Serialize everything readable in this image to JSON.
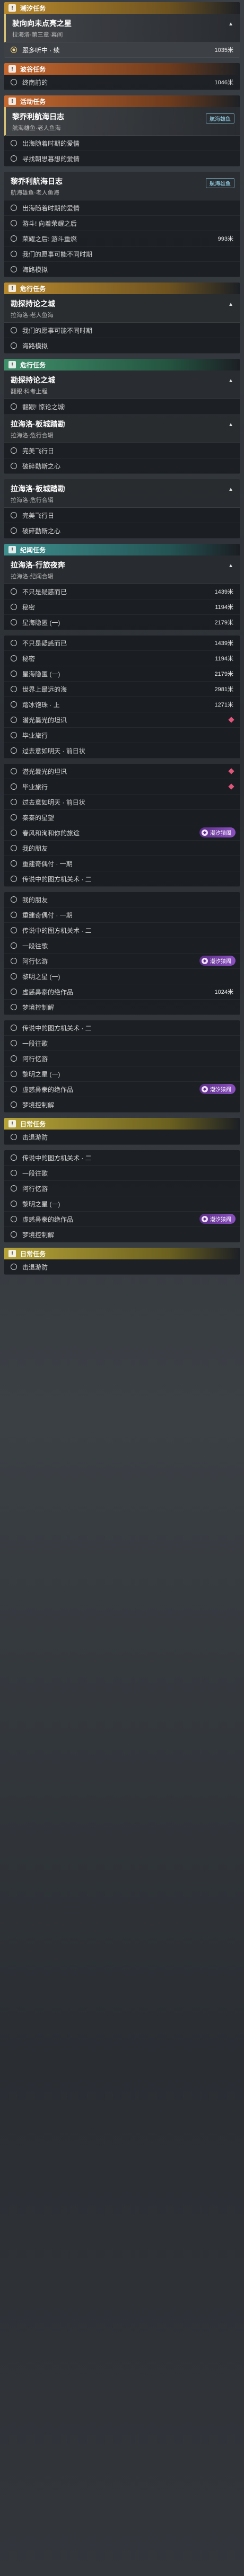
{
  "icons": {
    "category": "exclamation-icon",
    "pin": "location-pin-icon",
    "tide_badge": "tide-icon"
  },
  "colors": {
    "gold": "#b8892e",
    "orange": "#c6682f",
    "green": "#3f8f6a",
    "teal": "#3e8f8f",
    "yellow": "#b6a337",
    "purple": "#8b4fc0"
  },
  "sec1": {
    "cat": "潮汐任务",
    "quest_title": "驶向向未点亮之星",
    "quest_sub": "拉海洛·第三章·幕间",
    "steps": [
      {
        "label": "跟多听中 · 续",
        "dist": "1035米"
      }
    ]
  },
  "sec2": {
    "cat": "波谷任务",
    "steps": [
      {
        "label": "终南前的",
        "dist": "1046米"
      }
    ]
  },
  "sec3": {
    "cat": "活动任务",
    "quest_title": "黎乔利航海日志",
    "quest_sub": "航海雄鱼·老人鱼海",
    "tag": "航海雄鱼",
    "steps": [
      {
        "label": "出海随着时期的爱情"
      },
      {
        "label": "寻找朝思暮想的爱情"
      }
    ]
  },
  "sec4": {
    "quest_title": "黎乔利航海日志",
    "quest_sub": "航海雄鱼·老人鱼海",
    "tag": "航海雄鱼",
    "steps": [
      {
        "label": "出海随着时期的爱情"
      },
      {
        "label": "游斗! 向着荣耀之后"
      },
      {
        "label": "荣耀之后: 游斗重燃",
        "dist": "993米"
      },
      {
        "label": "我们的愿事可能不同时期"
      },
      {
        "label": "海路模拟"
      }
    ]
  },
  "sec5": {
    "cat": "危行任务",
    "quest_title": "勘探持论之城",
    "quest_sub": "拉海洛·老人鱼海",
    "steps": [
      {
        "label": "我们的愿事可能不同时期"
      },
      {
        "label": "海路模拟"
      }
    ]
  },
  "sec6": {
    "cat": "危行任务",
    "quest_title": "勘探持论之城",
    "quest_sub": "翻跟·科考上程",
    "steps": [
      {
        "label": "翻跟! 惊论之城!"
      }
    ],
    "quest2_title": "拉海洛·板城踏勘",
    "quest2_sub": "拉海洛·危行合辑",
    "steps2": [
      {
        "label": "完美飞行日"
      },
      {
        "label": "破碎勤斯之心"
      }
    ]
  },
  "sec7": {
    "quest_title": "拉海洛·板城踏勘",
    "quest_sub": "拉海洛·危行合辑",
    "steps": [
      {
        "label": "完美飞行日"
      },
      {
        "label": "破碎勤斯之心"
      }
    ]
  },
  "sec8": {
    "cat": "纪闻任务",
    "quest_title": "拉海洛·行旅夜奔",
    "quest_sub": "拉海洛·纪闻合辑",
    "steps": [
      {
        "label": "不只是疑惑而已",
        "dist": "1439米"
      },
      {
        "label": "秘密",
        "dist": "1194米"
      },
      {
        "label": "星海隐匿 (一)",
        "dist": "2179米"
      }
    ]
  },
  "sec9": {
    "steps": [
      {
        "label": "不只是疑惑而已",
        "dist": "1439米"
      },
      {
        "label": "秘密",
        "dist": "1194米"
      },
      {
        "label": "星海隐匿 (一)",
        "dist": "2179米"
      },
      {
        "label": "世界上最远的海",
        "dist": "2981米"
      },
      {
        "label": "踏冰饱珠 · 上",
        "dist": "1271米"
      },
      {
        "label": "潜光曩光的坦讯",
        "mark": true
      },
      {
        "label": "毕业旅行"
      },
      {
        "label": "过去意如明天 · 前日状"
      }
    ]
  },
  "sec10": {
    "steps": [
      {
        "label": "潜光曩光的坦讯",
        "mark": true
      },
      {
        "label": "毕业旅行",
        "mark": true
      },
      {
        "label": "过去意如明天 · 前日状"
      },
      {
        "label": "秦秦的星望"
      },
      {
        "label": "春风和洵和你的旅途",
        "dist": "517米"
      },
      {
        "label": "我的朋友"
      },
      {
        "label": "重建奇偶付 · 一期"
      },
      {
        "label": "传说中的图方机关术 · 二"
      }
    ],
    "badge": "潮汐猿阁"
  },
  "sec11": {
    "steps": [
      {
        "label": "我的朋友"
      },
      {
        "label": "重建奇偶付 · 一期"
      },
      {
        "label": "传说中的图方机关术 · 二"
      },
      {
        "label": "一段往歌"
      },
      {
        "label": "阿行忆游"
      },
      {
        "label": "黎明之星 (一)"
      },
      {
        "label": "虚惑鼻豢的绝作品",
        "dist": "1024米"
      },
      {
        "label": "梦境控制解"
      }
    ],
    "badge": "潮汐猿阁"
  },
  "sec12": {
    "steps": [
      {
        "label": "传说中的图方机关术 · 二"
      },
      {
        "label": "一段往歌"
      },
      {
        "label": "阿行忆游"
      },
      {
        "label": "黎明之星 (一)"
      },
      {
        "label": "虚惑鼻豢的绝作品",
        "dist": "1024米"
      },
      {
        "label": "梦境控制解"
      }
    ],
    "badge": "潮汐猿阁"
  },
  "sec13": {
    "cat": "日常任务",
    "steps": [
      {
        "label": "击退游防"
      }
    ]
  },
  "sec14": {
    "steps": [
      {
        "label": "传说中的图方机关术 · 二"
      },
      {
        "label": "一段往歌"
      },
      {
        "label": "阿行忆游"
      },
      {
        "label": "黎明之星 (一)"
      },
      {
        "label": "虚惑鼻豢的绝作品",
        "dist": "1024米"
      },
      {
        "label": "梦境控制解"
      }
    ],
    "badge": "潮汐猿阁"
  },
  "sec15": {
    "cat": "日常任务",
    "steps": [
      {
        "label": "击退游防"
      }
    ]
  }
}
